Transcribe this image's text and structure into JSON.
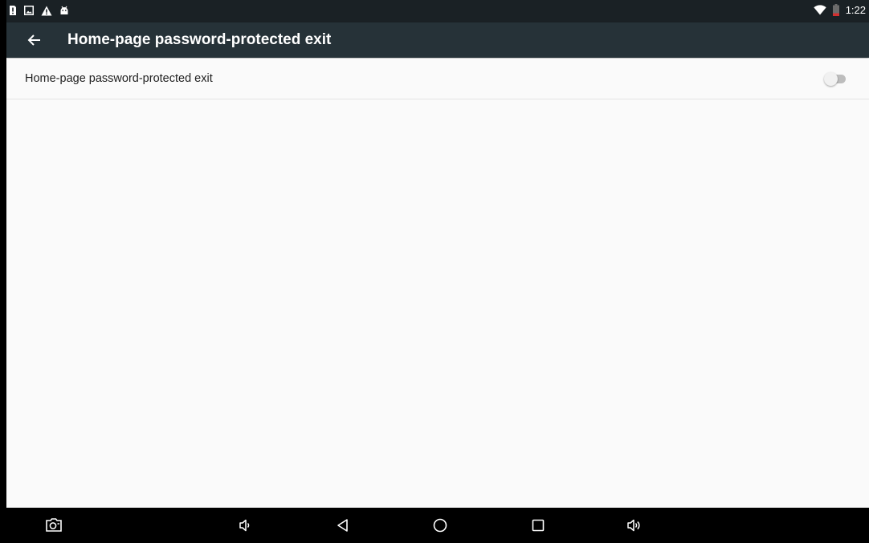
{
  "status_bar": {
    "time": "1:22",
    "left_icons": [
      "sim-alert-icon",
      "image-notification-icon",
      "warning-icon",
      "android-debug-icon"
    ],
    "right_icons": [
      "wifi-icon",
      "battery-low-icon"
    ]
  },
  "app_bar": {
    "title": "Home-page password-protected exit",
    "back_icon": "arrow-back-icon"
  },
  "settings": {
    "items": [
      {
        "label": "Home-page password-protected exit",
        "toggle_on": false
      }
    ]
  },
  "nav_bar": {
    "buttons": [
      "screenshot-icon",
      "volume-down-icon",
      "back-triangle-icon",
      "home-circle-icon",
      "recents-square-icon",
      "volume-up-icon"
    ]
  },
  "colors": {
    "status_bar": "#1a2125",
    "app_bar": "#263238",
    "background": "#fafafa",
    "nav_bar": "#000000",
    "switch_off_track": "#bdbdbd",
    "switch_off_thumb": "#f1f1f1"
  }
}
